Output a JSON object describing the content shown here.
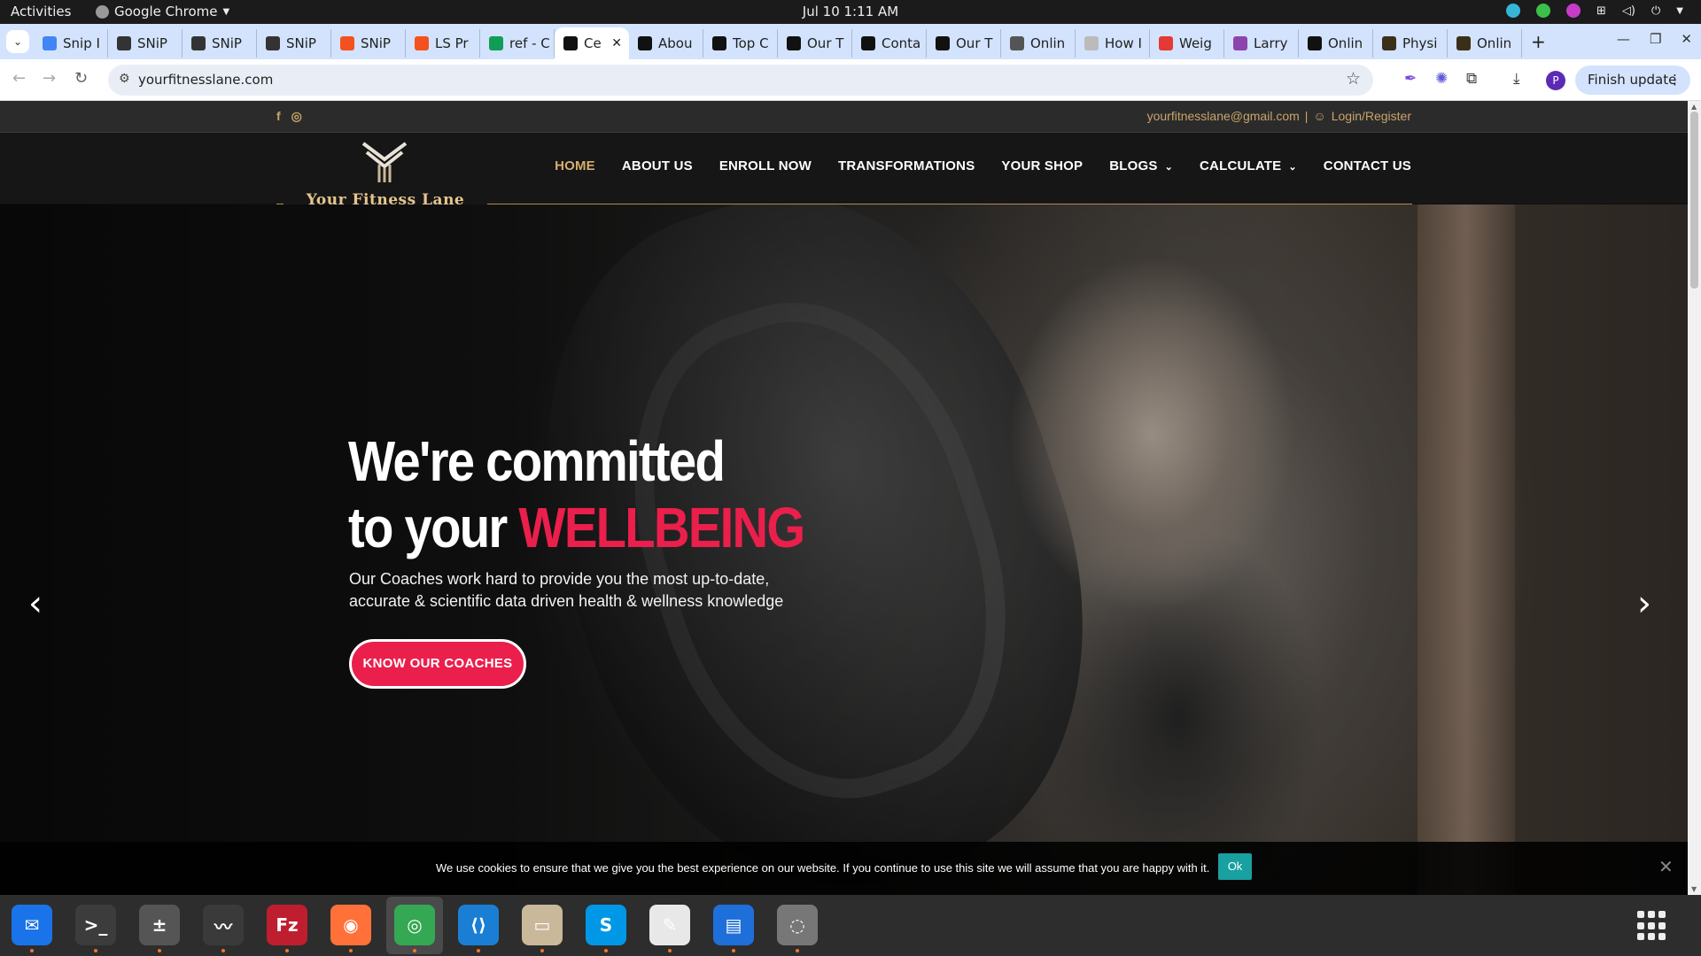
{
  "system": {
    "activities": "Activities",
    "app_name": "Google Chrome",
    "clock": "Jul 10  1:11 AM"
  },
  "browser": {
    "tabs": [
      {
        "label": "Snip I",
        "color": "#4285f4"
      },
      {
        "label": "SNiP",
        "color": "#333333"
      },
      {
        "label": "SNiP",
        "color": "#333333"
      },
      {
        "label": "SNiP",
        "color": "#333333"
      },
      {
        "label": "SNiP",
        "color": "#f4511e"
      },
      {
        "label": "LS Pr",
        "color": "#f4511e"
      },
      {
        "label": "ref - C",
        "color": "#0f9d58"
      },
      {
        "label": "Ce",
        "color": "#111111",
        "active": true
      },
      {
        "label": "Abou",
        "color": "#111111"
      },
      {
        "label": "Top C",
        "color": "#111111"
      },
      {
        "label": "Our T",
        "color": "#111111"
      },
      {
        "label": "Conta",
        "color": "#111111"
      },
      {
        "label": "Our T",
        "color": "#111111"
      },
      {
        "label": "Onlin",
        "color": "#555555"
      },
      {
        "label": "How I",
        "color": "#bbbbbb"
      },
      {
        "label": "Weig",
        "color": "#e53935"
      },
      {
        "label": "Larry",
        "color": "#8e44ad"
      },
      {
        "label": "Onlin",
        "color": "#111111"
      },
      {
        "label": "Physi",
        "color": "#3b2f1a"
      },
      {
        "label": "Onlin",
        "color": "#3b2f1a"
      }
    ],
    "new_tab": "+",
    "url": "yourfitnesslane.com",
    "profile_initial": "P",
    "finish_update": "Finish update"
  },
  "site": {
    "email": "yourfitnesslane@gmail.com",
    "separator": "|",
    "login": "Login/Register",
    "logo_text": "Your Fitness Lane",
    "nav": [
      {
        "label": "HOME",
        "active": true
      },
      {
        "label": "ABOUT US"
      },
      {
        "label": "ENROLL NOW"
      },
      {
        "label": "TRANSFORMATIONS"
      },
      {
        "label": "YOUR SHOP"
      },
      {
        "label": "BLOGS",
        "dropdown": true
      },
      {
        "label": "CALCULATE",
        "dropdown": true
      },
      {
        "label": "CONTACT US"
      }
    ],
    "hero": {
      "line1": "We're committed",
      "line2_prefix": "to your ",
      "line2_accent": "WELLBEING",
      "sub_line1": "Our Coaches work hard to provide you the most up-to-date,",
      "sub_line2": "accurate & scientific data driven health & wellness knowledge",
      "button": "KNOW OUR COACHES",
      "prev": "‹",
      "next": "›"
    },
    "cookie": {
      "message": "We use cookies to ensure that we give you the best experience on our website. If you continue to use this site we will assume that you are happy with it.",
      "ok": "Ok",
      "close": "✕"
    },
    "colors": {
      "accent": "#ea1f4c",
      "gold": "#d6ae6d",
      "teal": "#19a0a0"
    }
  },
  "dock": [
    {
      "name": "thunderbird",
      "color": "#1a73e8",
      "glyph": "✉"
    },
    {
      "name": "terminal",
      "color": "#3c3c3c",
      "glyph": ">_"
    },
    {
      "name": "calculator",
      "color": "#555555",
      "glyph": "±"
    },
    {
      "name": "system-monitor",
      "color": "#3a3a3a",
      "glyph": "〰"
    },
    {
      "name": "filezilla",
      "color": "#bf1e2e",
      "glyph": "Fz"
    },
    {
      "name": "firefox",
      "color": "#ff7139",
      "glyph": "◉"
    },
    {
      "name": "chrome",
      "color": "#34a853",
      "glyph": "◎"
    },
    {
      "name": "vscode",
      "color": "#1a7fd4",
      "glyph": "⟨⟩"
    },
    {
      "name": "files",
      "color": "#c9b89a",
      "glyph": "▭"
    },
    {
      "name": "skype",
      "color": "#0098e6",
      "glyph": "S"
    },
    {
      "name": "text-editor",
      "color": "#e8e8e8",
      "glyph": "✎"
    },
    {
      "name": "document-viewer",
      "color": "#1e6fd9",
      "glyph": "▤"
    },
    {
      "name": "disks",
      "color": "#777777",
      "glyph": "◌"
    }
  ],
  "apps_grid": "Show Applications"
}
